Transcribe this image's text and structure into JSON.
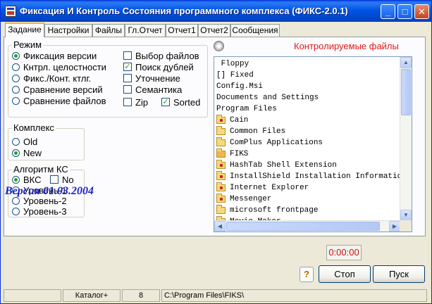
{
  "window": {
    "title": "Фиксация И Контроль Состояния программного комплекса (ФИКС-2.0.1)",
    "min_glyph": "_",
    "max_glyph": "□",
    "close_glyph": "✕"
  },
  "tabs": [
    "Задание",
    "Настройки",
    "Файлы",
    "Гл.Отчет",
    "Отчет1",
    "Отчет2",
    "Сообщения"
  ],
  "mode_group": {
    "label": "Режим",
    "radios": [
      {
        "label": "Фиксация версии",
        "selected": true
      },
      {
        "label": "Кнтрл. целостности",
        "selected": false
      },
      {
        "label": "Фикс./Конт. ктлг.",
        "selected": false
      },
      {
        "label": "Сравнение версий",
        "selected": false
      },
      {
        "label": "Сравнение  файлов",
        "selected": false
      }
    ],
    "checks": [
      {
        "label": "Выбор файлов",
        "checked": false
      },
      {
        "label": "Поиск дублей",
        "checked": true
      },
      {
        "label": "Уточнение",
        "checked": false
      },
      {
        "label": "Семантика",
        "checked": false
      },
      {
        "label": "Zip",
        "checked": false
      },
      {
        "label": "Sorted",
        "checked": true
      }
    ]
  },
  "complex_group": {
    "label": "Комплекс",
    "radios": [
      {
        "label": "Old",
        "selected": false
      },
      {
        "label": "New",
        "selected": true
      }
    ]
  },
  "algo_group": {
    "label": "Алгоритм КС",
    "radios": [
      {
        "label": "ВКС",
        "selected": true
      },
      {
        "label": "Уровень-1",
        "selected": false
      },
      {
        "label": "Уровень-2",
        "selected": false
      },
      {
        "label": "Уровень-3",
        "selected": false
      }
    ],
    "no_check": {
      "label": "No",
      "checked": false
    }
  },
  "version_text": "Версия 01.03.2004",
  "file_panel": {
    "title": "Контролируемые файлы",
    "items": [
      {
        "text": " Floppy",
        "icon": "none"
      },
      {
        "text": "[] Fixed",
        "icon": "none"
      },
      {
        "text": "Config.Msi",
        "icon": "none"
      },
      {
        "text": "Documents and Settings",
        "icon": "none"
      },
      {
        "text": "Program Files",
        "icon": "none"
      },
      {
        "text": "Cain",
        "icon": "folder-locked"
      },
      {
        "text": "Common Files",
        "icon": "folder"
      },
      {
        "text": "ComPlus Applications",
        "icon": "folder"
      },
      {
        "text": "FIKS",
        "icon": "folder-open"
      },
      {
        "text": "HashTab Shell Extension",
        "icon": "folder-locked"
      },
      {
        "text": "InstallShield Installation Informatic",
        "icon": "folder-locked"
      },
      {
        "text": "Internet Explorer",
        "icon": "folder-locked"
      },
      {
        "text": "Messenger",
        "icon": "folder-locked"
      },
      {
        "text": "microsoft frontpage",
        "icon": "folder"
      },
      {
        "text": "Movie Maker",
        "icon": "folder-locked"
      }
    ]
  },
  "timer": "0:00:00",
  "buttons": {
    "help": "?",
    "stop": "Стоп",
    "start": "Пуск"
  },
  "status": {
    "cell1": "",
    "cell2": "Каталог+",
    "cell3": "8",
    "cell4": "C:\\Program Files\\FIKS\\"
  },
  "colors": {
    "title_red": "#e01818",
    "version_blue": "#1a23c9",
    "timer_red": "#d01010"
  }
}
